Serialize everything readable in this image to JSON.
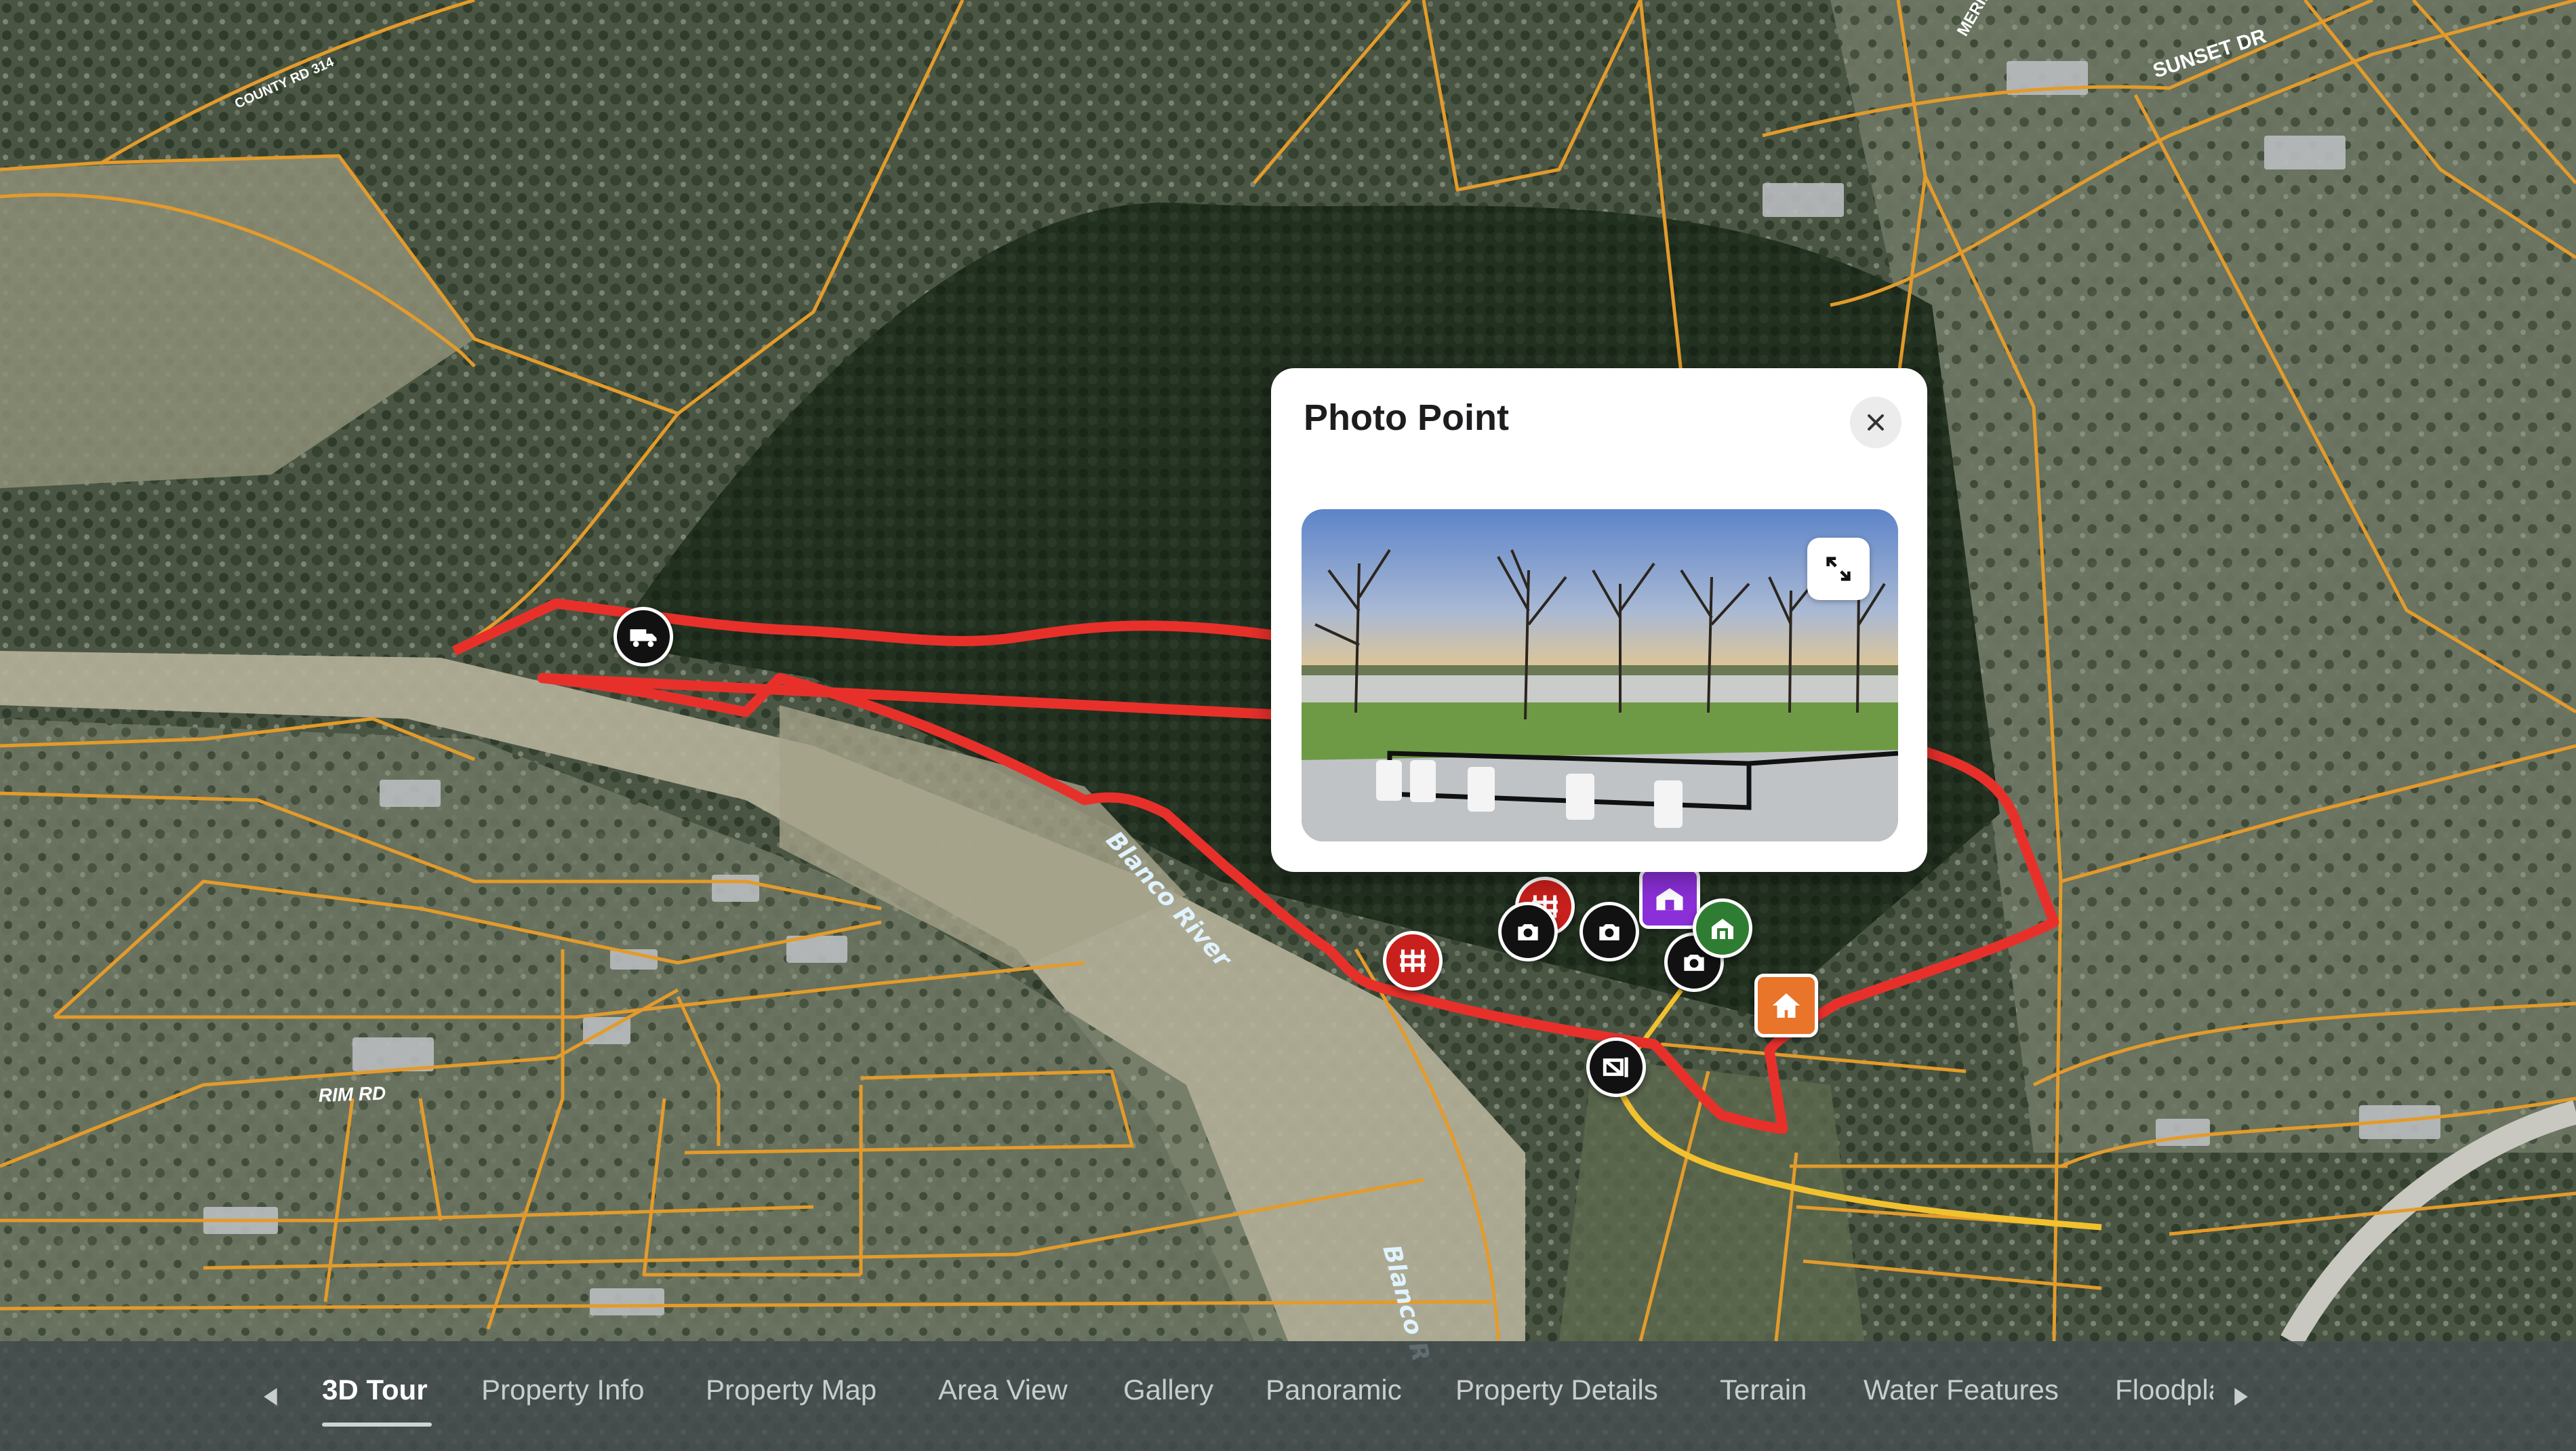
{
  "map": {
    "road_labels": {
      "county_rd": "COUNTY RD 314",
      "meridian": "MERIDIA",
      "sunset": "SUNSET DR",
      "rim": "RIM RD"
    },
    "river_labels": [
      "Blanco River",
      "Blanco R"
    ],
    "colors": {
      "boundary": "#e8302b",
      "parcel_lines": "#e49b2b",
      "access_road": "#f2c12e"
    }
  },
  "popup": {
    "title": "Photo Point",
    "close_icon": "close-icon",
    "expand_icon": "expand-icon"
  },
  "markers": [
    {
      "type": "vehicle-access",
      "icon": "truck-icon"
    },
    {
      "type": "fence",
      "icon": "fence-icon"
    },
    {
      "type": "fence",
      "icon": "fence-icon"
    },
    {
      "type": "photo-point",
      "icon": "camera-icon"
    },
    {
      "type": "photo-point",
      "icon": "camera-icon"
    },
    {
      "type": "photo-point",
      "icon": "camera-icon"
    },
    {
      "type": "building",
      "icon": "barn-icon"
    },
    {
      "type": "barn",
      "icon": "barn-icon"
    },
    {
      "type": "home",
      "icon": "home-icon"
    },
    {
      "type": "gate",
      "icon": "gate-icon"
    }
  ],
  "nav": {
    "tabs": [
      {
        "label": "3D Tour",
        "active": true
      },
      {
        "label": "Property Info"
      },
      {
        "label": "Property Map"
      },
      {
        "label": "Area View"
      },
      {
        "label": "Gallery"
      },
      {
        "label": "Panoramic"
      },
      {
        "label": "Property Details"
      },
      {
        "label": "Terrain"
      },
      {
        "label": "Water Features"
      },
      {
        "label": "Floodplain"
      }
    ],
    "prev_icon": "chevron-left-icon",
    "next_icon": "chevron-right-icon"
  }
}
